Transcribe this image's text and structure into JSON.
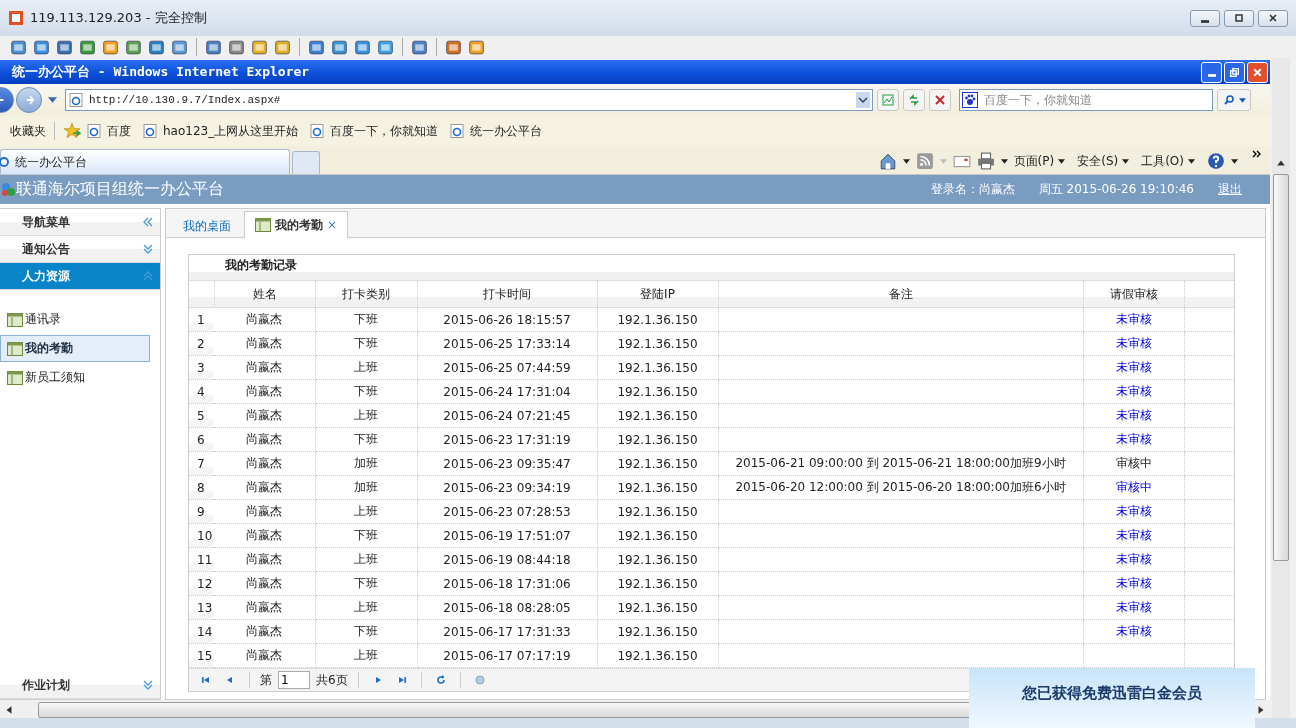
{
  "remote_window": {
    "title": "119.113.129.203 - 完全控制"
  },
  "browser": {
    "title": "统一办公平台 - Windows Internet Explorer",
    "address": "http://10.130.9.7/Index.aspx#",
    "search_placeholder": "百度一下，你就知道",
    "favorites_label": "收藏夹",
    "favorites": [
      "百度",
      "hao123_上网从这里开始",
      "百度一下，你就知道",
      "统一办公平台"
    ],
    "tabs": [
      {
        "label": "统一办公平台",
        "selected": true
      }
    ],
    "commands": [
      "页面(P)",
      "安全(S)",
      "工具(O)"
    ]
  },
  "app": {
    "title": "联通海尔项目组统一办公平台",
    "login": "登录名：尚嬴杰",
    "datetime": "周五 2015-06-26 19:10:46",
    "logout": "退出"
  },
  "sidebar": {
    "title": "导航菜单",
    "sections": [
      {
        "label": "通知公告",
        "expanded": false
      },
      {
        "label": "人力资源",
        "expanded": true,
        "items": [
          {
            "label": "通讯录",
            "selected": false
          },
          {
            "label": "我的考勤",
            "selected": true
          },
          {
            "label": "新员工须知",
            "selected": false
          }
        ]
      },
      {
        "label": "作业计划",
        "expanded": false
      }
    ]
  },
  "tabs": [
    {
      "label": "我的桌面",
      "selected": false
    },
    {
      "label": "我的考勤",
      "selected": true,
      "close": "×"
    }
  ],
  "table": {
    "title": "我的考勤记录",
    "columns": [
      "姓名",
      "打卡类别",
      "打卡时间",
      "登陆IP",
      "备注",
      "请假审核"
    ],
    "rows": [
      {
        "n": "1",
        "name": "尚嬴杰",
        "type": "下班",
        "time": "2015-06-26 18:15:57",
        "ip": "192.1.36.150",
        "review": "未审核",
        "link": true
      },
      {
        "n": "2",
        "name": "尚嬴杰",
        "type": "下班",
        "time": "2015-06-25 17:33:14",
        "ip": "192.1.36.150",
        "review": "未审核",
        "link": true
      },
      {
        "n": "3",
        "name": "尚嬴杰",
        "type": "上班",
        "time": "2015-06-25 07:44:59",
        "ip": "192.1.36.150",
        "review": "未审核",
        "link": true
      },
      {
        "n": "4",
        "name": "尚嬴杰",
        "type": "下班",
        "time": "2015-06-24 17:31:04",
        "ip": "192.1.36.150",
        "review": "未审核",
        "link": true
      },
      {
        "n": "5",
        "name": "尚嬴杰",
        "type": "上班",
        "time": "2015-06-24 07:21:45",
        "ip": "192.1.36.150",
        "review": "未审核",
        "link": true
      },
      {
        "n": "6",
        "name": "尚嬴杰",
        "type": "下班",
        "time": "2015-06-23 17:31:19",
        "ip": "192.1.36.150",
        "review": "未审核",
        "link": true
      },
      {
        "n": "7",
        "name": "尚嬴杰",
        "type": "加班",
        "time": "2015-06-23 09:35:47",
        "ip": "192.1.36.150",
        "note": "2015-06-21 09:00:00 到 2015-06-21 18:00:00加班9小时",
        "review": "审核中",
        "link": false
      },
      {
        "n": "8",
        "name": "尚嬴杰",
        "type": "加班",
        "time": "2015-06-23 09:34:19",
        "ip": "192.1.36.150",
        "note": "2015-06-20 12:00:00 到 2015-06-20 18:00:00加班6小时",
        "review": "审核中",
        "link": true
      },
      {
        "n": "9",
        "name": "尚嬴杰",
        "type": "上班",
        "time": "2015-06-23 07:28:53",
        "ip": "192.1.36.150",
        "review": "未审核",
        "link": true
      },
      {
        "n": "10",
        "name": "尚嬴杰",
        "type": "下班",
        "time": "2015-06-19 17:51:07",
        "ip": "192.1.36.150",
        "review": "未审核",
        "link": true
      },
      {
        "n": "11",
        "name": "尚嬴杰",
        "type": "上班",
        "time": "2015-06-19 08:44:18",
        "ip": "192.1.36.150",
        "review": "未审核",
        "link": true
      },
      {
        "n": "12",
        "name": "尚嬴杰",
        "type": "下班",
        "time": "2015-06-18 17:31:06",
        "ip": "192.1.36.150",
        "review": "未审核",
        "link": true
      },
      {
        "n": "13",
        "name": "尚嬴杰",
        "type": "上班",
        "time": "2015-06-18 08:28:05",
        "ip": "192.1.36.150",
        "review": "未审核",
        "link": true
      },
      {
        "n": "14",
        "name": "尚嬴杰",
        "type": "下班",
        "time": "2015-06-17 17:31:33",
        "ip": "192.1.36.150",
        "review": "未审核",
        "link": true
      },
      {
        "n": "15",
        "name": "尚嬴杰",
        "type": "上班",
        "time": "2015-06-17 07:17:19",
        "ip": "192.1.36.150"
      }
    ]
  },
  "pager": {
    "prefix": "第",
    "page": "1",
    "suffix": "共6页"
  },
  "popup": {
    "text": "您已获得免费迅雷白金会员"
  }
}
